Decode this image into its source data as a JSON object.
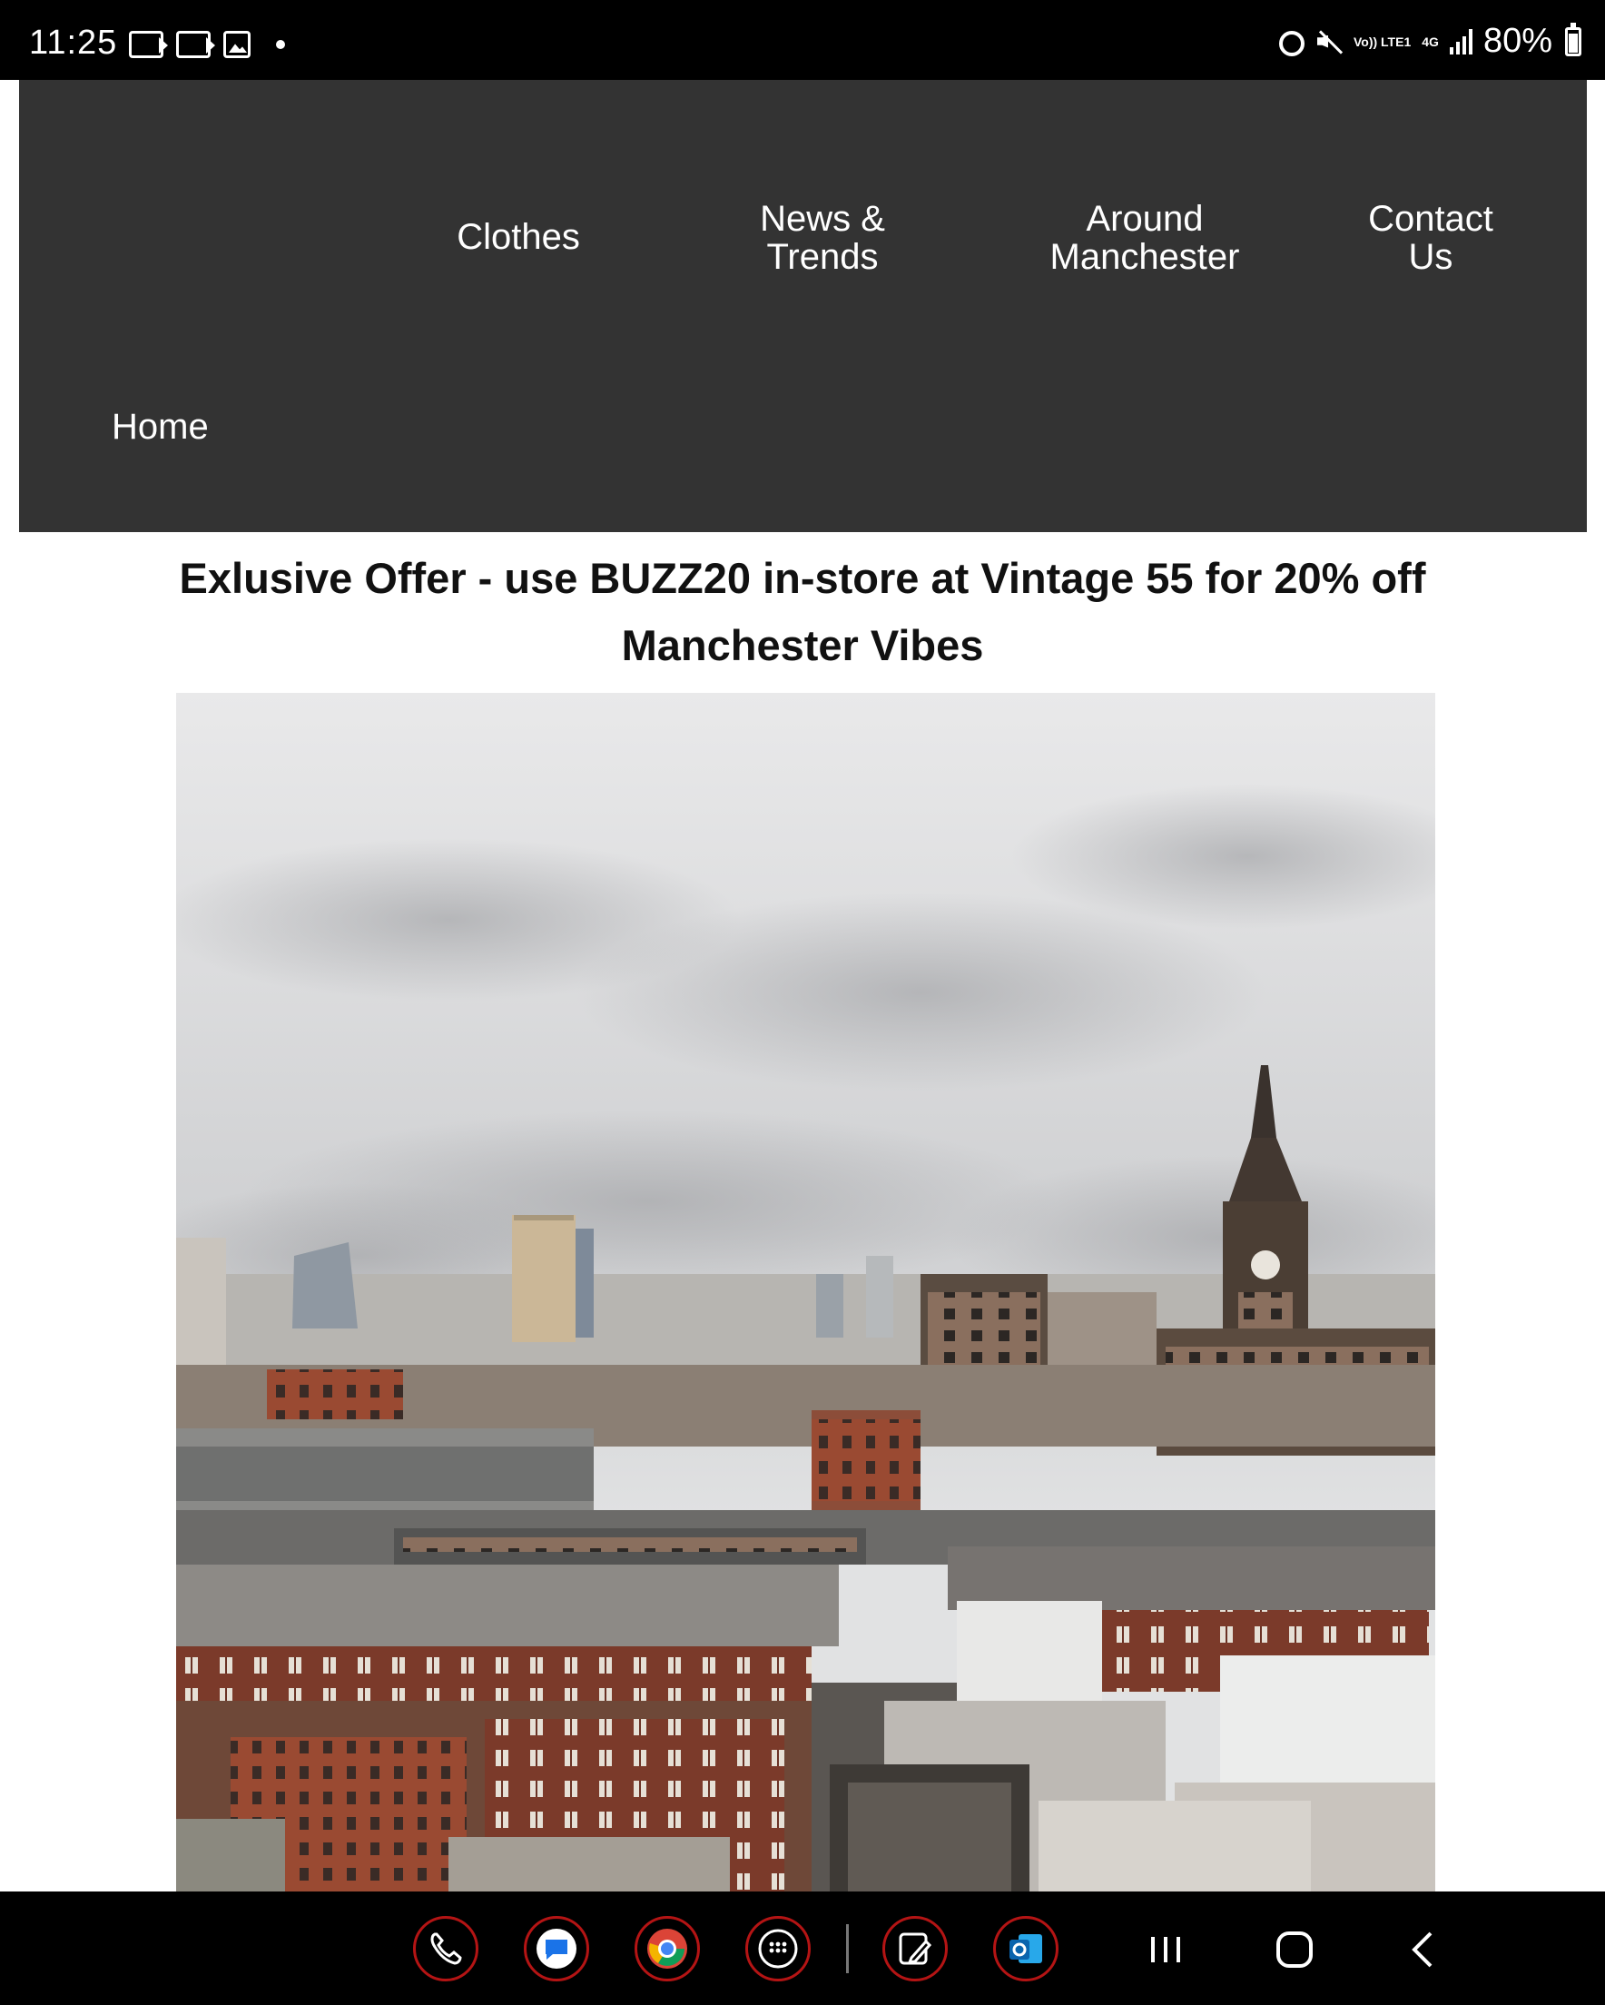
{
  "status_bar": {
    "time": "11:25",
    "battery": "80%",
    "network_volte": "Vo)) LTE1",
    "network_type": "4G",
    "left_icons": [
      "outlook-notification-icon",
      "outlook-notification-icon",
      "gallery-notification-icon",
      "dot-icon"
    ],
    "right_icons": [
      "alarm-icon",
      "mute-icon",
      "volte-icon",
      "4g-icon",
      "signal-icon",
      "battery-icon"
    ]
  },
  "nav": {
    "background": "#333333",
    "items": [
      {
        "label": "Clothes"
      },
      {
        "label_line1": "News &",
        "label_line2": "Trends"
      },
      {
        "label_line1": "Around",
        "label_line2": "Manchester"
      },
      {
        "label_line1": "Contact",
        "label_line2": "Us"
      },
      {
        "label": "Home"
      }
    ]
  },
  "main": {
    "offer_text": "Exlusive Offer - use BUZZ20 in-store at Vintage 55 for 20% off",
    "heading": "Manchester Vibes",
    "image_subject": "manchester-skyline-photo"
  },
  "navbar": {
    "dock_apps": [
      "phone-icon",
      "messages-icon",
      "chrome-icon",
      "app-drawer-icon",
      "notes-icon",
      "outlook-icon"
    ],
    "accent": "#b41414",
    "system_buttons": [
      "recents-icon",
      "home-icon",
      "back-icon"
    ]
  }
}
